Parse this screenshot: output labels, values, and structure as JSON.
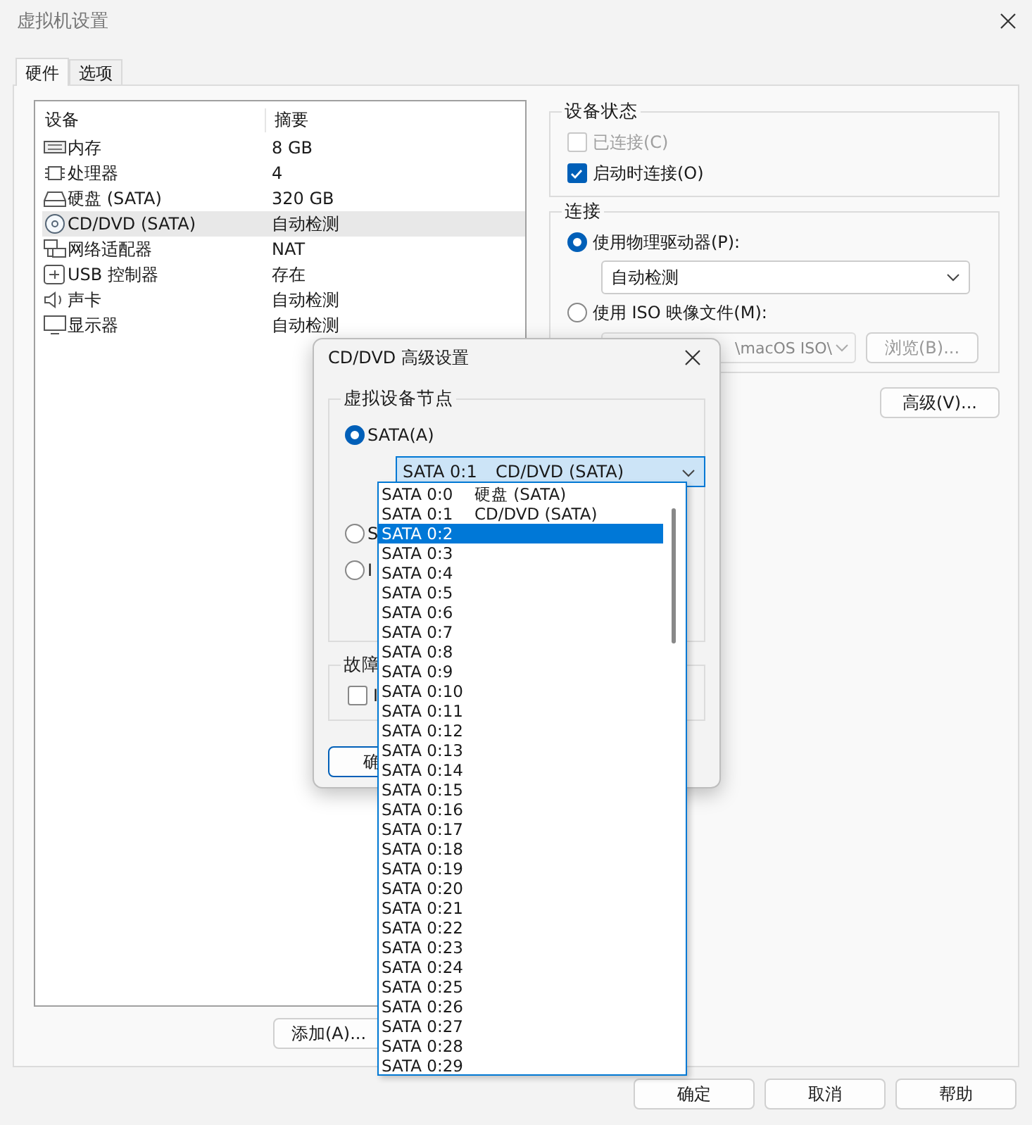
{
  "window": {
    "title": "虚拟机设置"
  },
  "tabs": [
    {
      "label": "硬件",
      "selected": true
    },
    {
      "label": "选项",
      "selected": false
    }
  ],
  "device_table": {
    "columns": [
      "设备",
      "摘要"
    ],
    "rows": [
      {
        "kind": "memory",
        "device": "内存",
        "summary": "8 GB",
        "selected": false
      },
      {
        "kind": "cpu",
        "device": "处理器",
        "summary": "4",
        "selected": false
      },
      {
        "kind": "disk",
        "device": "硬盘 (SATA)",
        "summary": "320 GB",
        "selected": false
      },
      {
        "kind": "cd",
        "device": "CD/DVD (SATA)",
        "summary": "自动检测",
        "selected": true
      },
      {
        "kind": "network",
        "device": "网络适配器",
        "summary": "NAT",
        "selected": false
      },
      {
        "kind": "usb",
        "device": "USB 控制器",
        "summary": "存在",
        "selected": false
      },
      {
        "kind": "sound",
        "device": "声卡",
        "summary": "自动检测",
        "selected": false
      },
      {
        "kind": "display",
        "device": "显示器",
        "summary": "自动检测",
        "selected": false
      }
    ]
  },
  "add_button": "添加(A)...",
  "device_status": {
    "title": "设备状态",
    "options": [
      {
        "label": "已连接(C)",
        "checked": false,
        "disabled": true
      },
      {
        "label": "启动时连接(O)",
        "checked": true,
        "disabled": false
      }
    ]
  },
  "connection": {
    "title": "连接",
    "physical": {
      "label": "使用物理驱动器(P):",
      "selected": true
    },
    "drive": "自动检测",
    "iso": {
      "label": "使用 ISO 映像文件(M):",
      "selected": false
    },
    "iso_path": "\\macOS ISO\\",
    "browse_button": "浏览(B)..."
  },
  "advanced_button": "高级(V)...",
  "footer_buttons": [
    "确定",
    "取消",
    "帮助"
  ],
  "dialog": {
    "title": "CD/DVD 高级设置",
    "group_title": "虚拟设备节点",
    "radios": [
      {
        "label": "SATA(A)",
        "selected": true
      },
      {
        "label": "S",
        "selected": false
      },
      {
        "label": "I",
        "selected": false
      }
    ],
    "select": {
      "code": "SATA 0:1",
      "device": "CD/DVD (SATA)"
    },
    "fault_title": "故障",
    "fault_checkbox": {
      "label": "I",
      "checked": false
    },
    "ok_button": "确"
  },
  "dropdown": [
    {
      "code": "SATA 0:0",
      "device": "硬盘 (SATA)",
      "selected": false
    },
    {
      "code": "SATA 0:1",
      "device": "CD/DVD (SATA)",
      "selected": false
    },
    {
      "code": "SATA 0:2",
      "selected": true
    },
    {
      "code": "SATA 0:3",
      "selected": false
    },
    {
      "code": "SATA 0:4",
      "selected": false
    },
    {
      "code": "SATA 0:5",
      "selected": false
    },
    {
      "code": "SATA 0:6",
      "selected": false
    },
    {
      "code": "SATA 0:7",
      "selected": false
    },
    {
      "code": "SATA 0:8",
      "selected": false
    },
    {
      "code": "SATA 0:9",
      "selected": false
    },
    {
      "code": "SATA 0:10",
      "selected": false
    },
    {
      "code": "SATA 0:11",
      "selected": false
    },
    {
      "code": "SATA 0:12",
      "selected": false
    },
    {
      "code": "SATA 0:13",
      "selected": false
    },
    {
      "code": "SATA 0:14",
      "selected": false
    },
    {
      "code": "SATA 0:15",
      "selected": false
    },
    {
      "code": "SATA 0:16",
      "selected": false
    },
    {
      "code": "SATA 0:17",
      "selected": false
    },
    {
      "code": "SATA 0:18",
      "selected": false
    },
    {
      "code": "SATA 0:19",
      "selected": false
    },
    {
      "code": "SATA 0:20",
      "selected": false
    },
    {
      "code": "SATA 0:21",
      "selected": false
    },
    {
      "code": "SATA 0:22",
      "selected": false
    },
    {
      "code": "SATA 0:23",
      "selected": false
    },
    {
      "code": "SATA 0:24",
      "selected": false
    },
    {
      "code": "SATA 0:25",
      "selected": false
    },
    {
      "code": "SATA 0:26",
      "selected": false
    },
    {
      "code": "SATA 0:27",
      "selected": false
    },
    {
      "code": "SATA 0:28",
      "selected": false
    },
    {
      "code": "SATA 0:29",
      "selected": false
    }
  ]
}
